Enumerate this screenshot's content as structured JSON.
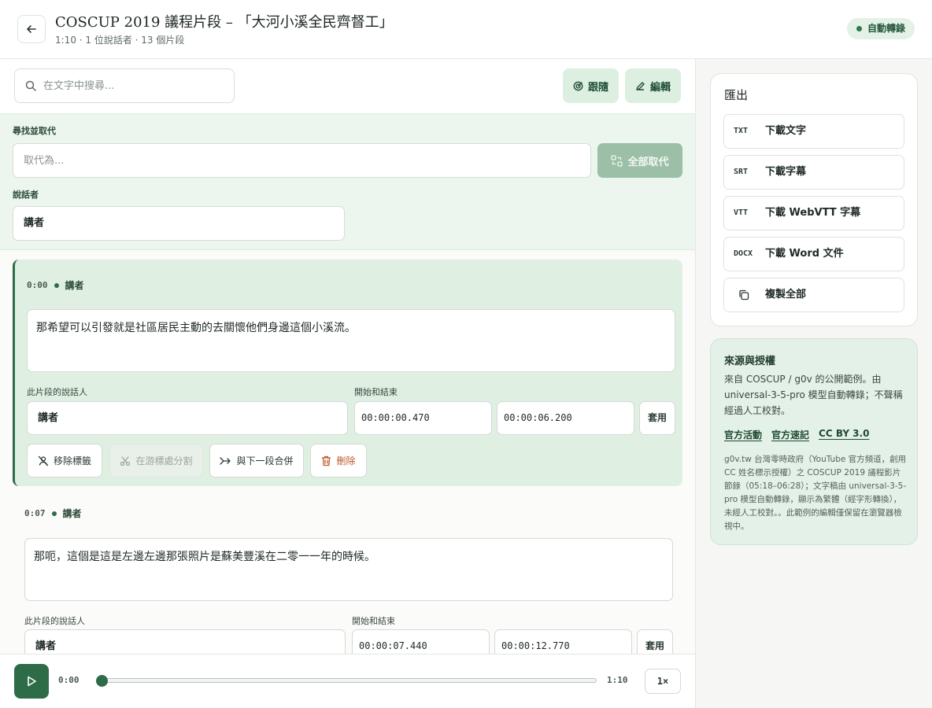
{
  "header": {
    "title": "COSCUP 2019 議程片段 – 「大河小溪全民齊督工」",
    "subtitle": "1:10 · 1 位說話者 · 13 個片段",
    "status": "自動轉錄"
  },
  "toolbar": {
    "search_placeholder": "在文字中搜尋...",
    "follow_label": "跟隨",
    "edit_label": "編輯"
  },
  "replace_panel": {
    "find_replace_label": "尋找並取代",
    "replace_placeholder": "取代為...",
    "replace_all_label": "全部取代",
    "speaker_label": "說話者",
    "speaker_value": "講者"
  },
  "segment_labels": {
    "speaker_field": "此片段的說話人",
    "time_field": "開始和結束",
    "apply": "套用",
    "remove_label": "移除標籤",
    "split": "在游標處分割",
    "merge": "與下一段合併",
    "delete": "刪除"
  },
  "segments": [
    {
      "time": "0:00",
      "speaker": "講者",
      "text": "那希望可以引發就是社區居民主動的去關懷他們身邊這個小溪流。",
      "start": "00:00:00.470",
      "end": "00:00:06.200"
    },
    {
      "time": "0:07",
      "speaker": "講者",
      "text": "那呃，這個是這是左邊左邊那張照片是蘇美豐溪在二零一一年的時候。",
      "start": "00:00:07.440",
      "end": "00:00:12.770"
    }
  ],
  "player": {
    "current": "0:00",
    "duration": "1:10",
    "speed": "1×",
    "progress": 0
  },
  "export": {
    "title": "匯出",
    "items": [
      {
        "tag": "TXT",
        "label": "下載文字"
      },
      {
        "tag": "SRT",
        "label": "下載字幕"
      },
      {
        "tag": "VTT",
        "label": "下載 WebVTT 字幕"
      },
      {
        "tag": "DOCX",
        "label": "下載 Word 文件"
      }
    ],
    "copy_label": "複製全部"
  },
  "source": {
    "title": "來源與授權",
    "description": "來自 COSCUP / g0v 的公開範例。由 universal-3-5-pro 模型自動轉錄；不聲稱經過人工校對。",
    "links": [
      "官方活動",
      "官方速記",
      "CC BY 3.0"
    ],
    "note": "g0v.tw 台灣零時政府（YouTube 官方頻道，創用CC 姓名標示授權）之 COSCUP 2019 議程影片節錄（05:18–06:28）；文字稿由 universal-3-5-pro 模型自動轉錄，顯示為繁體（經字形轉換），未經人工校對。。此範例的編輯僅保留在瀏覽器檢視中。"
  },
  "colors": {
    "accent": "#2e6b47",
    "accent_soft": "#dff0e3",
    "danger": "#c0572c"
  }
}
